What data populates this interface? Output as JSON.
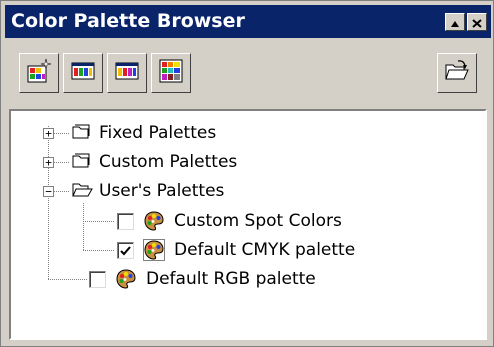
{
  "window": {
    "title": "Color Palette Browser"
  },
  "titlebar_buttons": [
    {
      "name": "minimize-button",
      "icon": "up-triangle-icon"
    },
    {
      "name": "close-button",
      "icon": "close-x-icon"
    }
  ],
  "toolbar": {
    "buttons": [
      {
        "name": "new-palette-button",
        "icon": "new-palette-icon"
      },
      {
        "name": "open-palette-button",
        "icon": "palette-strip-icon"
      },
      {
        "name": "palette-editor-button",
        "icon": "palette-strip-icon"
      },
      {
        "name": "color-grid-button",
        "icon": "color-grid-icon"
      },
      {
        "name": "open-folder-button",
        "icon": "open-folder-icon"
      }
    ]
  },
  "tree": {
    "items": [
      {
        "label": "Fixed Palettes",
        "type": "folder",
        "expander": "+",
        "level": 0
      },
      {
        "label": "Custom Palettes",
        "type": "folder",
        "expander": "+",
        "level": 0
      },
      {
        "label": "User's Palettes",
        "type": "folder-open",
        "expander": "−",
        "level": 0
      },
      {
        "label": "Custom Spot Colors",
        "type": "palette",
        "checked": false,
        "level": 1
      },
      {
        "label": "Default CMYK palette",
        "type": "palette",
        "checked": true,
        "level": 1
      },
      {
        "label": "Default RGB palette",
        "type": "palette",
        "checked": false,
        "level": 0
      }
    ]
  },
  "colors": {
    "titlebar": "#0a246a",
    "face": "#d4d0c8",
    "tree_bg": "#ffffff"
  }
}
